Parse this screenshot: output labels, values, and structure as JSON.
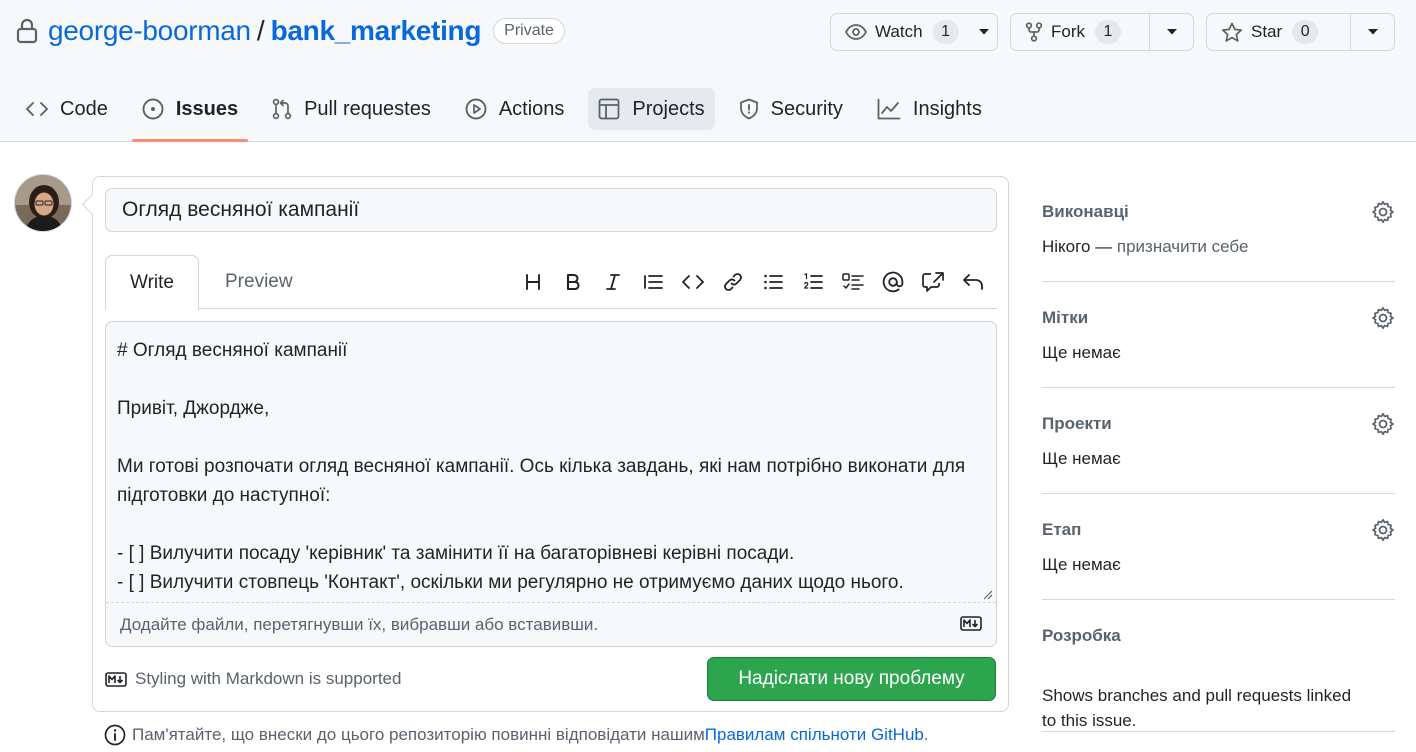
{
  "repo": {
    "owner": "george-boorman",
    "slash": "/",
    "name": "bank_marketing",
    "visibility": "Private"
  },
  "header_buttons": {
    "watch": {
      "label": "Watch",
      "count": "1"
    },
    "fork": {
      "label": "Fork",
      "count": "1"
    },
    "star": {
      "label": "Star",
      "count": "0"
    }
  },
  "tabs": [
    {
      "label": "Code",
      "icon": "code-icon"
    },
    {
      "label": "Issues",
      "icon": "issue-opened-icon",
      "active": true
    },
    {
      "label": "Pull requestes",
      "icon": "git-pull-request-icon"
    },
    {
      "label": "Actions",
      "icon": "play-icon"
    },
    {
      "label": "Projects",
      "icon": "table-icon"
    },
    {
      "label": "Security",
      "icon": "shield-icon"
    },
    {
      "label": "Insights",
      "icon": "graph-icon"
    }
  ],
  "issue": {
    "title_value": "Огляд весняної кампанії",
    "editor_tabs": {
      "write": "Write",
      "preview": "Preview"
    },
    "body": "# Огляд весняної кампанії\n\nПривіт, Джордже,\n\nМи готові розпочати огляд весняної кампанії. Ось кілька завдань, які нам потрібно виконати для підготовки до наступної:\n\n- [ ] Вилучити посаду 'керівник' та замінити її на багаторівневі керівні посади.\n- [ ] Вилучити стовпець 'Контакт', оскільки ми регулярно не отримуємо даних щодо нього.",
    "attach_hint": "Додайте файли, перетягнувши їх, вибравши або вставивши.",
    "markdown_hint": "Styling with Markdown is supported",
    "submit_label": "Надіслати нову проблему"
  },
  "footnote": {
    "text": "Пам'ятайте, що внески до цього репозиторію повинні відповідати нашим ",
    "link": "Правилам спільноти GitHub",
    "end": "."
  },
  "sidebar": {
    "assignees": {
      "title": "Виконавці",
      "value_prefix": "Нікого — ",
      "value_link": "призначити себе"
    },
    "labels": {
      "title": "Мітки",
      "value": "Ще немає"
    },
    "projects": {
      "title": "Проекти",
      "value": "Ще немає"
    },
    "milestone": {
      "title": "Етап",
      "value": "Ще немає"
    },
    "development": {
      "title": "Розробка",
      "value": "Shows branches and pull requests linked to this issue."
    }
  },
  "colors": {
    "link": "#0969da",
    "submit": "#2da44e",
    "active_tab_underline": "#fd8c73"
  }
}
